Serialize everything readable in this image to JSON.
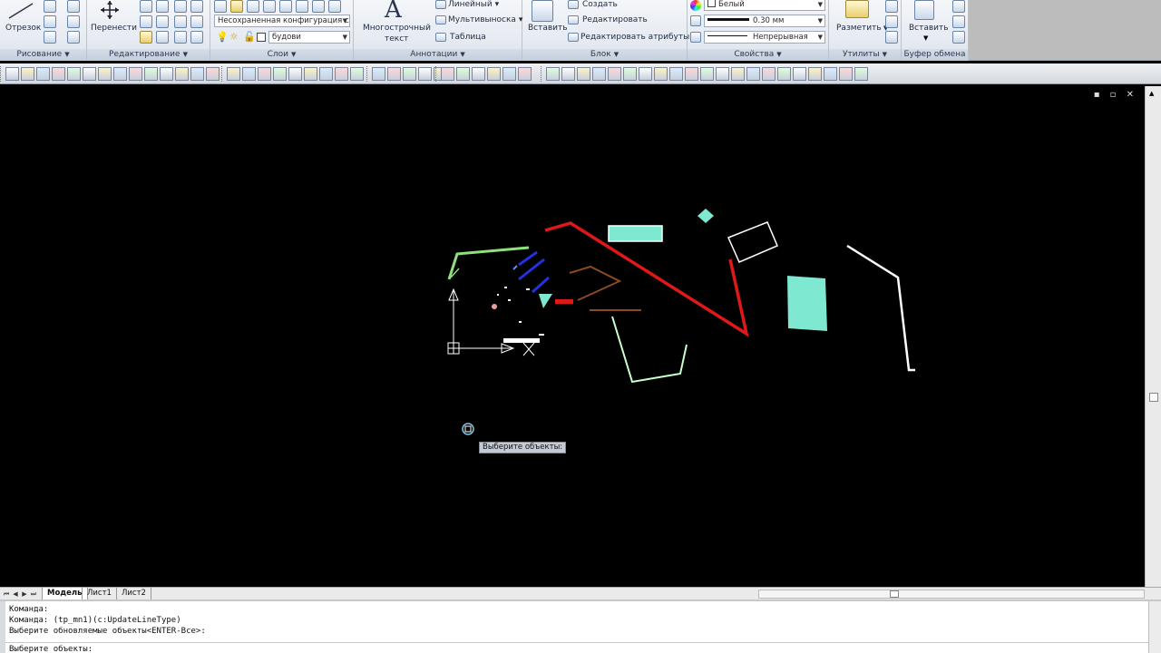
{
  "ribbon": {
    "draw": {
      "line_label": "Отрезок",
      "title": "Рисование"
    },
    "modify": {
      "move_label": "Перенести",
      "title": "Редактирование"
    },
    "layers": {
      "layer_state": "Несохраненная конфигурация сл",
      "current_layer": "будови",
      "title": "Слои"
    },
    "annotation": {
      "mtext_line1": "Многострочный",
      "mtext_line2": "текст",
      "linear_label": "Линейный",
      "multileader_label": "Мультивыноска",
      "table_label": "Таблица",
      "title": "Аннотации"
    },
    "block": {
      "insert_label": "Вставить",
      "create_label": "Создать",
      "edit_label": "Редактировать",
      "edit_attr_label": "Редактировать атрибуты",
      "title": "Блок"
    },
    "properties": {
      "color": "Белый",
      "lineweight": "0.30 мм",
      "linetype": "Непрерывная",
      "title": "Свойства"
    },
    "utilities": {
      "measure_label": "Разметить",
      "title": "Утилиты"
    },
    "clipboard": {
      "paste_label": "Вставить",
      "title": "Буфер обмена"
    }
  },
  "viewport": {
    "tooltip": "Выберите объекты:",
    "controls": "▪ ▫ ✕"
  },
  "tabs": [
    {
      "label": "Модель"
    },
    {
      "label": "Лист1"
    },
    {
      "label": "Лист2"
    }
  ],
  "command": {
    "lines": [
      "Команда:",
      "Команда: (tp_mn1)(c:UpdateLineType)",
      "Выберите обновляемые объекты<ENTER-Все>:",
      "Выберите объекты:"
    ]
  },
  "colors": {
    "red": "#e01818",
    "cyan": "#7fe8d0",
    "blue": "#2233dd",
    "green": "#8fe07a",
    "brown": "#8a4a22",
    "white": "#ffffff"
  }
}
